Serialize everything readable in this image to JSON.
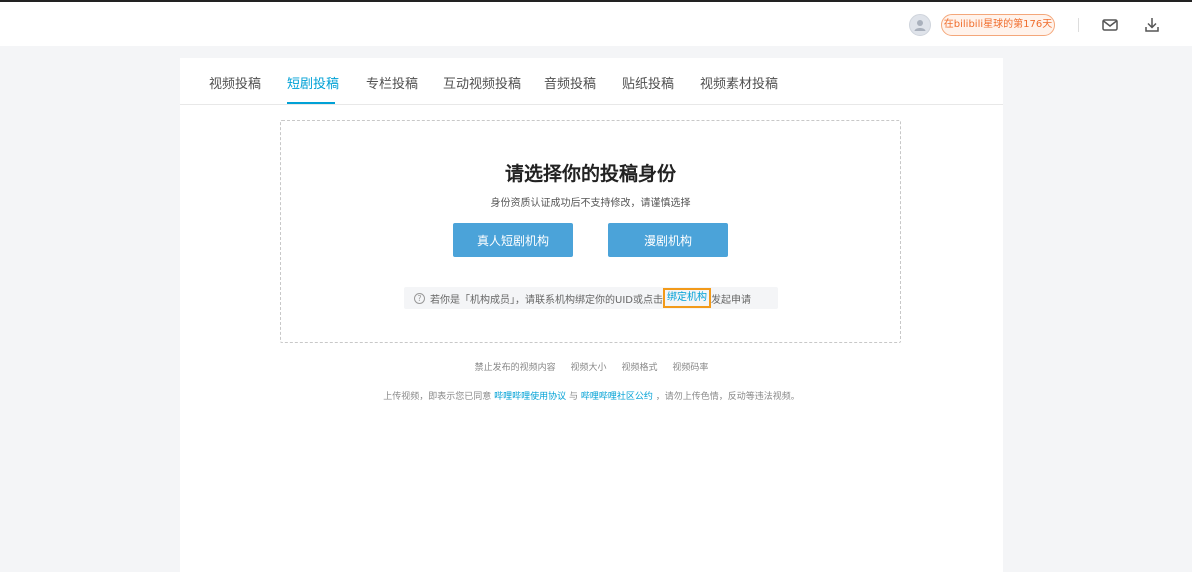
{
  "header": {
    "badge_text": "在bilibili星球的第176天",
    "icons": [
      "avatar-icon",
      "mail-icon",
      "download-icon"
    ]
  },
  "tabs": [
    {
      "label": "视频投稿",
      "active": false
    },
    {
      "label": "短剧投稿",
      "active": true
    },
    {
      "label": "专栏投稿",
      "active": false
    },
    {
      "label": "互动视频投稿",
      "active": false
    },
    {
      "label": "音频投稿",
      "active": false
    },
    {
      "label": "贴纸投稿",
      "active": false
    },
    {
      "label": "视频素材投稿",
      "active": false
    }
  ],
  "identity": {
    "title": "请选择你的投稿身份",
    "subtitle": "身份资质认证成功后不支持修改，请谨慎选择",
    "button_live": "真人短剧机构",
    "button_anime": "漫剧机构",
    "hint_before": "若你是「机构成员」，请联系机构绑定你的UID或点击",
    "hint_link": "绑定机构",
    "hint_after": "发起申请"
  },
  "footer": {
    "links": [
      "禁止发布的视频内容",
      "视频大小",
      "视频格式",
      "视频码率"
    ],
    "note_prefix": "上传视频，即表示您已同意",
    "note_link1": "哔哩哔哩使用协议",
    "note_and": "与",
    "note_link2": "哔哩哔哩社区公约",
    "note_suffix": "，请勿上传色情，反动等违法视频。"
  },
  "colors": {
    "accent": "#00a1d6",
    "button": "#4ba3d9",
    "badge": "#f06d2c",
    "highlight": "#f29a1a"
  }
}
